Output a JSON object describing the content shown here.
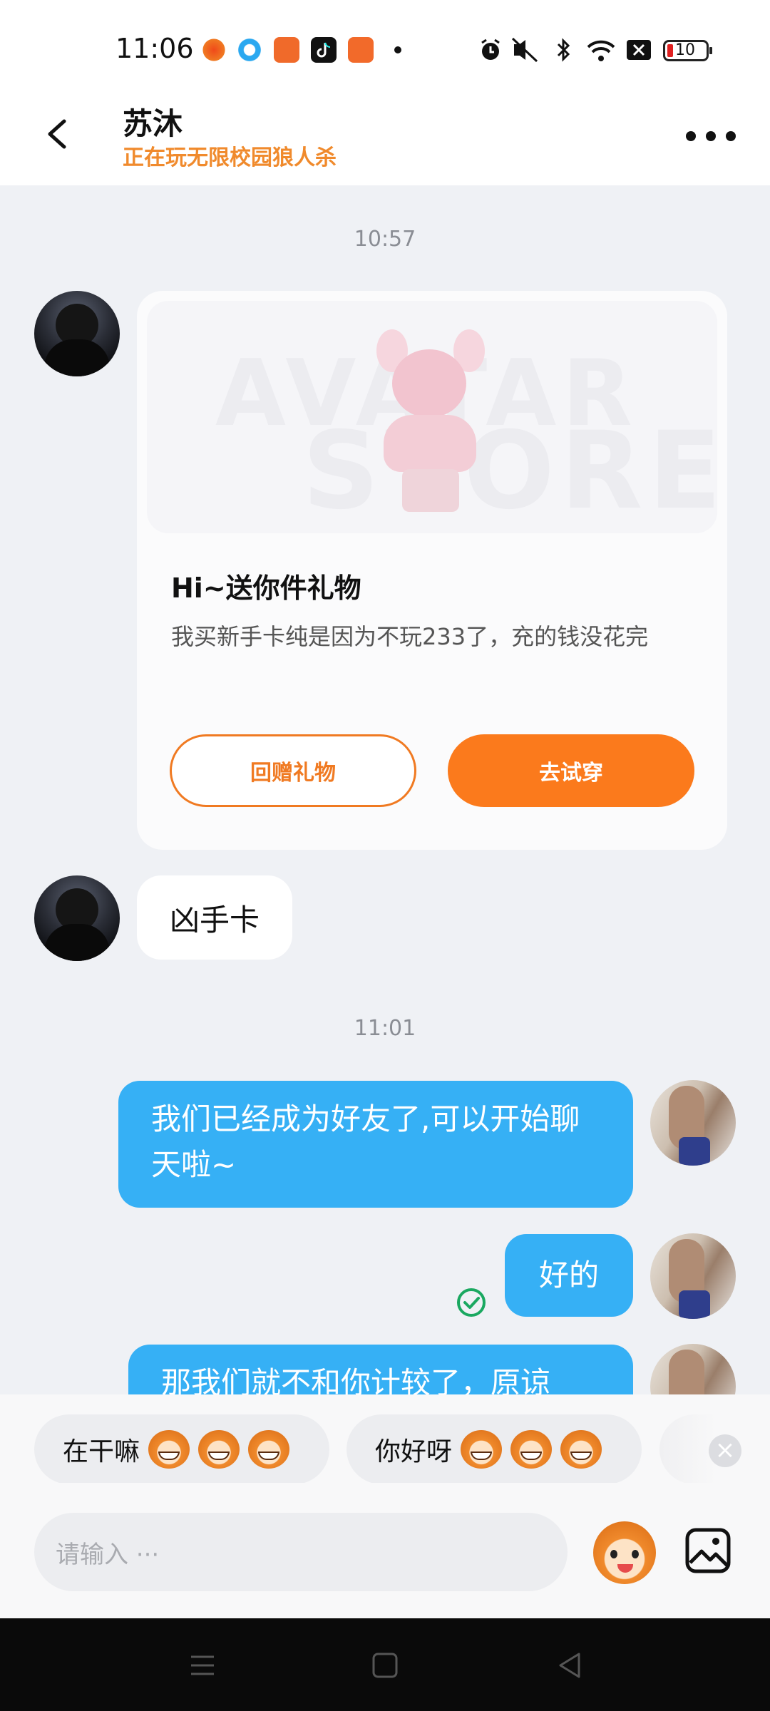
{
  "status_bar": {
    "time": "11:06",
    "battery": "10"
  },
  "header": {
    "title": "苏沐",
    "subtitle": "正在玩无限校园狼人杀"
  },
  "chat": {
    "timestamp_1": "10:57",
    "gift": {
      "watermark_top": "AVATAR",
      "watermark_bottom": "STORE",
      "title": "Hi~送你件礼物",
      "description": "我买新手卡纯是因为不玩233了，充的钱没花完",
      "return_gift_label": "回赠礼物",
      "try_on_label": "去试穿"
    },
    "incoming_text": "凶手卡",
    "timestamp_2": "11:01",
    "outgoing": [
      "我们已经成为好友了,可以开始聊天啦~",
      "好的",
      "那我们就不和你计较了，原谅"
    ]
  },
  "quick_replies": [
    {
      "label": "在干嘛"
    },
    {
      "label": "你好呀"
    }
  ],
  "input": {
    "placeholder": "请输入 ···"
  },
  "colors": {
    "accent_orange": "#fb7a1c",
    "bubble_blue": "#36b0f5",
    "subtitle_orange": "#f08a2c"
  },
  "icons": [
    "back-arrow-icon",
    "more-icon",
    "read-check-icon",
    "close-icon",
    "mascot-emoji-icon",
    "picture-icon",
    "menu-icon",
    "home-icon",
    "back-icon"
  ]
}
